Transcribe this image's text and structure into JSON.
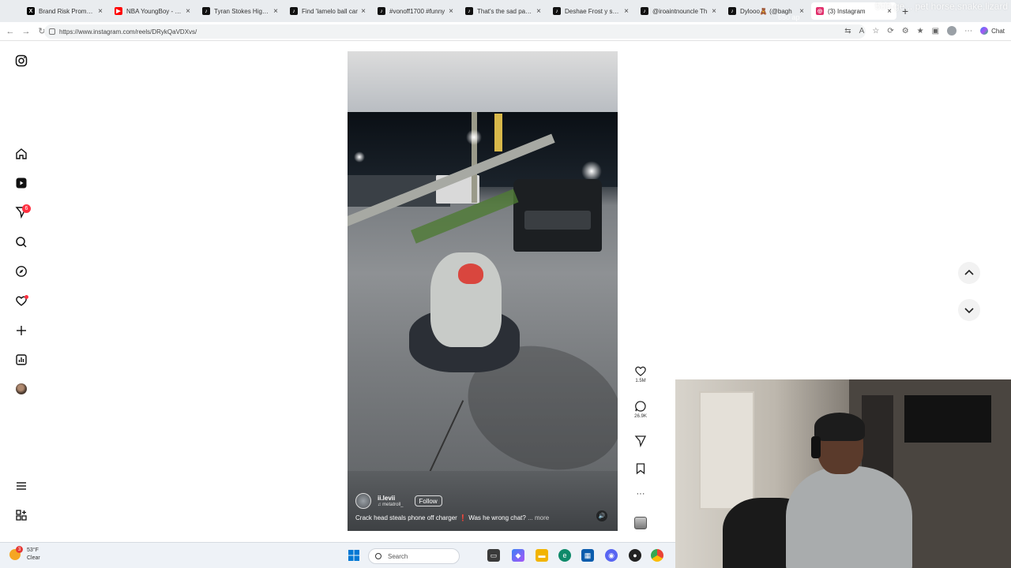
{
  "browser": {
    "tabs": [
      {
        "title": "Brand Risk Promotio",
        "icon": "x-logo-icon",
        "color": "#000000"
      },
      {
        "title": "NBA YoungBoy - Un",
        "icon": "youtube-icon",
        "color": "#ff0000"
      },
      {
        "title": "Tyran Stokes High Sc",
        "icon": "tiktok-icon",
        "color": "#111111"
      },
      {
        "title": "Find 'lamelo ball car",
        "icon": "tiktok-icon",
        "color": "#111111"
      },
      {
        "title": "#vonoff1700 #funny",
        "icon": "tiktok-icon",
        "color": "#111111"
      },
      {
        "title": "That's the sad part o",
        "icon": "tiktok-icon",
        "color": "#111111"
      },
      {
        "title": "Deshae Frost y sus li",
        "icon": "tiktok-icon",
        "color": "#111111"
      },
      {
        "title": "@iroaintnouncle Th",
        "icon": "tiktok-icon",
        "color": "#111111"
      },
      {
        "title": "Dylooo🧸 (@bagh",
        "icon": "tiktok-icon",
        "color": "#111111"
      },
      {
        "title": "(3) Instagram",
        "icon": "instagram-icon",
        "color": "#e1306c",
        "active": true
      }
    ],
    "overlay_text": "500-ge... pet horse,snake,lizard",
    "overlay_text2": "650 ap",
    "url": "https://www.instagram.com/reels/DRykQaVDXvs/",
    "chat_label": "Chat"
  },
  "sidebar": {
    "messages_badge": "6"
  },
  "reel": {
    "username": "ii.levii",
    "audio": "metatroll_",
    "follow_label": "Follow",
    "caption": "Crack head steals phone off charger ❗ Was he wrong chat?",
    "more_label": "... more",
    "likes": "1.5M",
    "comments": "26.9K"
  },
  "taskbar": {
    "temperature": "53°F",
    "condition": "Clear",
    "weather_badge": "3",
    "search_placeholder": "Search"
  },
  "colors": {
    "accent_red": "#ff3040",
    "taskbar_bg": "#eef2f7"
  }
}
